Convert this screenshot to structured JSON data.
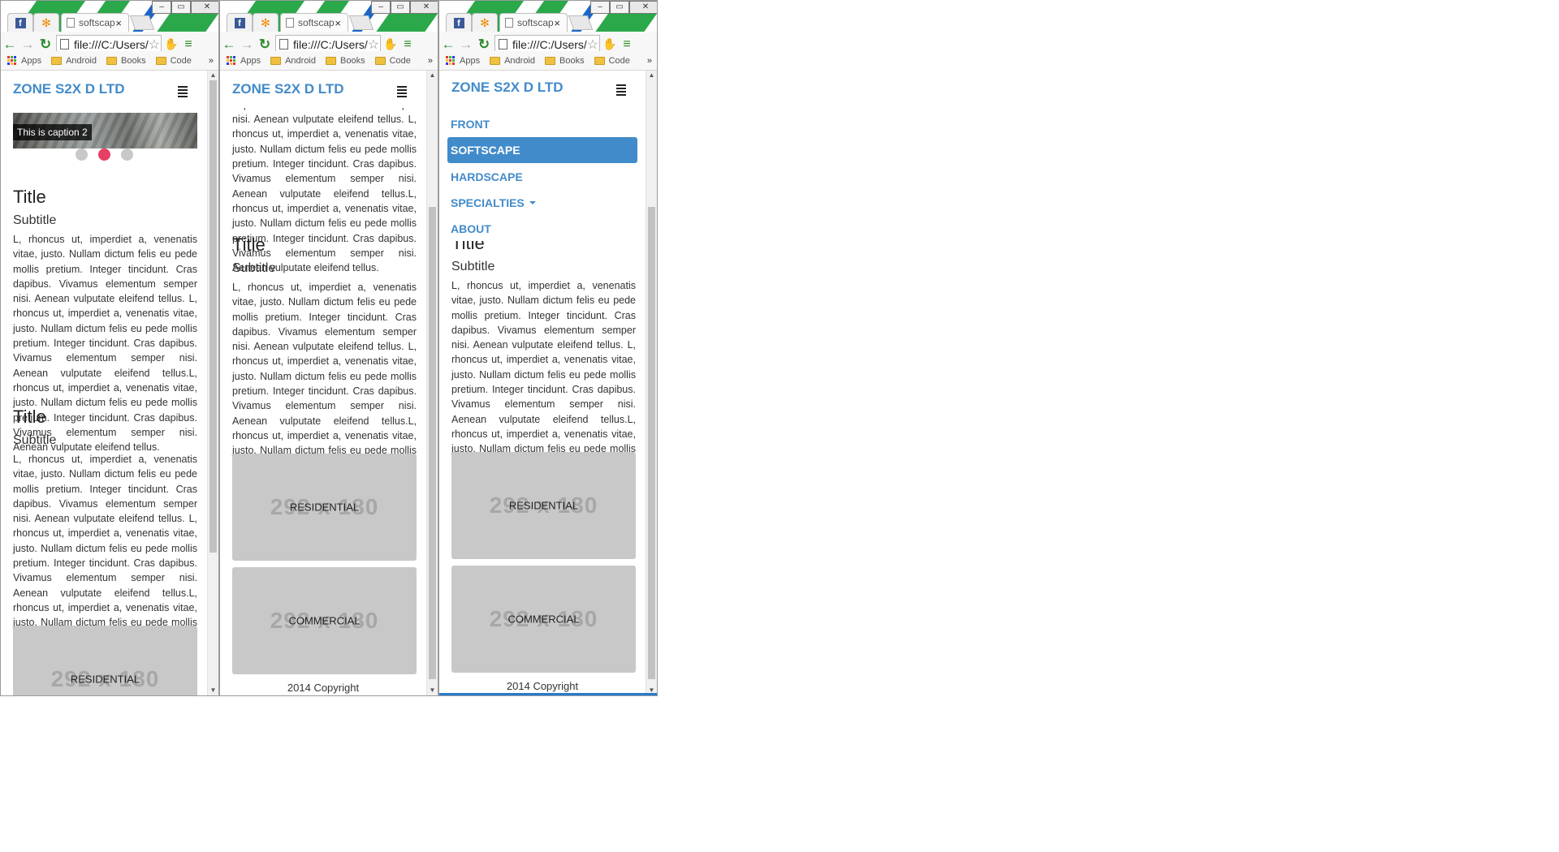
{
  "browser": {
    "tab_title": "softscap",
    "tab_close": "×",
    "address": "file:///C:/Users/",
    "bookmarks": [
      "Apps",
      "Android",
      "Books",
      "Code"
    ],
    "bookmarks_more": "»",
    "accent": "#2b7bcb"
  },
  "site": {
    "brand": "ZONE S2X D LTD",
    "brand_color": "#428bca",
    "carousel_caption": "This is caption 2",
    "carousel_active_index": 1,
    "article_title": "Title",
    "article_subtitle": "Subtitle",
    "paragraph": "L, rhoncus ut, imperdiet a, venenatis vitae, justo. Nullam dictum felis eu pede mollis pretium. Integer tincidunt. Cras dapibus. Vivamus elementum semper nisi. Aenean vulputate eleifend tellus. L, rhoncus ut, imperdiet a, venenatis vitae, justo. Nullam dictum felis eu pede mollis pretium. Integer tincidunt. Cras dapibus. Vivamus elementum semper nisi. Aenean vulputate eleifend tellus.L, rhoncus ut, imperdiet a, venenatis vitae, justo. Nullam dictum felis eu pede mollis pretium. Integer tincidunt. Cras dapibus. Vivamus elementum semper nisi. Aenean vulputate eleifend tellus.",
    "placeholder_dim": "292 x 180",
    "tile_residential": "RESIDENTIAL",
    "tile_commercial": "COMMERCIAL",
    "copyright": "2014 Copyright",
    "menu": {
      "front": "FRONT",
      "softscape": "SOFTSCAPE",
      "hardscape": "HARDSCAPE",
      "specialties": "SPECIALTIES",
      "about": "ABOUT"
    },
    "partial_title": "Title"
  }
}
